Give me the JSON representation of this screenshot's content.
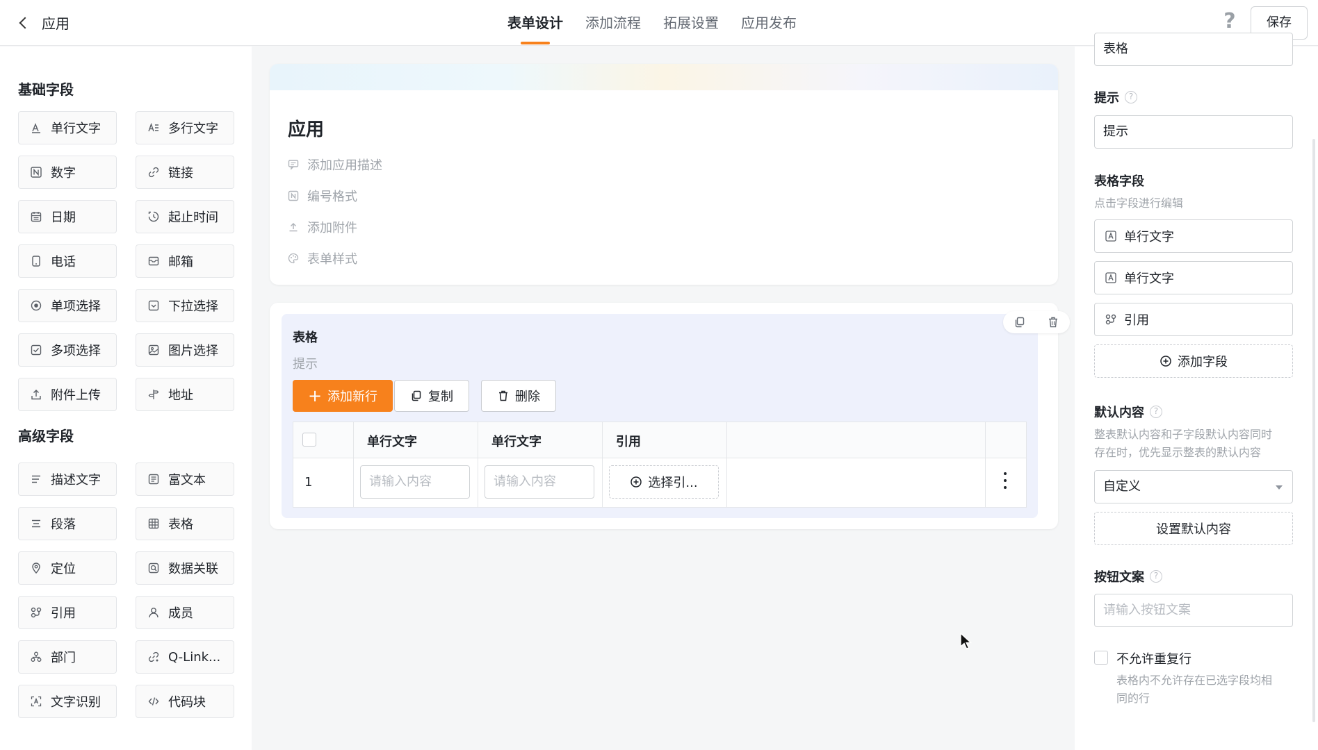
{
  "header": {
    "back_label": "应用",
    "tabs": [
      {
        "label": "表单设计",
        "active": true
      },
      {
        "label": "添加流程"
      },
      {
        "label": "拓展设置"
      },
      {
        "label": "应用发布"
      }
    ],
    "help": "?",
    "save_label": "保存",
    "accent_color": "#f7811c"
  },
  "palette": {
    "basic_title": "基础字段",
    "basic": [
      {
        "label": "单行文字",
        "icon": "text-line-icon"
      },
      {
        "label": "多行文字",
        "icon": "text-multi-icon"
      },
      {
        "label": "数字",
        "icon": "number-icon"
      },
      {
        "label": "链接",
        "icon": "link-icon"
      },
      {
        "label": "日期",
        "icon": "calendar-icon"
      },
      {
        "label": "起止时间",
        "icon": "time-range-icon"
      },
      {
        "label": "电话",
        "icon": "phone-icon"
      },
      {
        "label": "邮箱",
        "icon": "mail-icon"
      },
      {
        "label": "单项选择",
        "icon": "radio-icon"
      },
      {
        "label": "下拉选择",
        "icon": "dropdown-icon"
      },
      {
        "label": "多项选择",
        "icon": "checkbox-icon"
      },
      {
        "label": "图片选择",
        "icon": "image-icon"
      },
      {
        "label": "附件上传",
        "icon": "upload-icon"
      },
      {
        "label": "地址",
        "icon": "address-icon"
      }
    ],
    "advanced_title": "高级字段",
    "advanced": [
      {
        "label": "描述文字",
        "icon": "description-icon"
      },
      {
        "label": "富文本",
        "icon": "rich-text-icon"
      },
      {
        "label": "段落",
        "icon": "paragraph-icon"
      },
      {
        "label": "表格",
        "icon": "table-icon"
      },
      {
        "label": "定位",
        "icon": "location-icon"
      },
      {
        "label": "数据关联",
        "icon": "data-link-icon"
      },
      {
        "label": "引用",
        "icon": "reference-icon"
      },
      {
        "label": "成员",
        "icon": "member-icon"
      },
      {
        "label": "部门",
        "icon": "department-icon"
      },
      {
        "label": "Q-Link...",
        "icon": "qlink-icon"
      },
      {
        "label": "文字识别",
        "icon": "ocr-icon"
      },
      {
        "label": "代码块",
        "icon": "code-icon"
      }
    ]
  },
  "form": {
    "title": "应用",
    "meta": [
      {
        "label": "添加应用描述",
        "icon": "comment-icon"
      },
      {
        "label": "编号格式",
        "icon": "number-format-icon"
      },
      {
        "label": "添加附件",
        "icon": "attachment-icon"
      },
      {
        "label": "表单样式",
        "icon": "palette-icon"
      }
    ],
    "table": {
      "title": "表格",
      "hint": "提示",
      "add_row": "添加新行",
      "copy": "复制",
      "delete": "删除",
      "columns": [
        "单行文字",
        "单行文字",
        "引用"
      ],
      "row_number": "1",
      "input_placeholder": "请输入内容",
      "select_ref": "选择引..."
    }
  },
  "props": {
    "title_value": "表格",
    "hint_label": "提示",
    "hint_value": "提示",
    "fields_label": "表格字段",
    "fields_sub": "点击字段进行编辑",
    "fields": [
      {
        "label": "单行文字",
        "icon": "text-line-icon"
      },
      {
        "label": "单行文字",
        "icon": "text-line-icon"
      },
      {
        "label": "引用",
        "icon": "reference-icon"
      }
    ],
    "add_field": "添加字段",
    "default_label": "默认内容",
    "default_sub_1": "整表默认内容和子字段默认内容同时",
    "default_sub_2": "存在时，优先显示整表的默认内容",
    "default_select": "自定义",
    "set_default": "设置默认内容",
    "button_text_label": "按钮文案",
    "button_text_placeholder": "请输入按钮文案",
    "no_dup_label": "不允许重复行",
    "no_dup_sub_1": "表格内不允许存在已选字段均相",
    "no_dup_sub_2": "同的行"
  }
}
